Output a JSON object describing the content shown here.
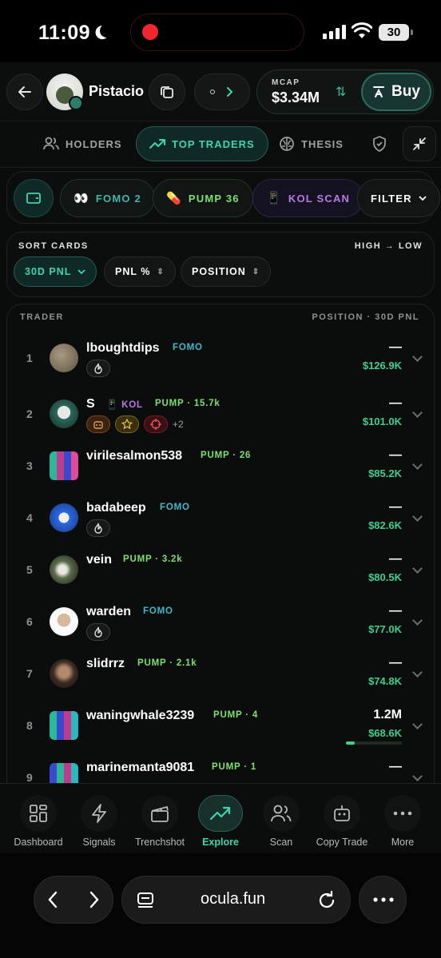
{
  "status_bar": {
    "time": "11:09",
    "battery": "30"
  },
  "token": {
    "name": "Pistacio",
    "mcap_label": "MCAP",
    "mcap_value": "$3.34M",
    "buy_label": "Buy"
  },
  "tabs": [
    {
      "label": "HOLDERS",
      "icon": "users-icon"
    },
    {
      "label": "TOP TRADERS",
      "icon": "trending-up-icon",
      "active": true
    },
    {
      "label": "THESIS",
      "icon": "brain-icon"
    }
  ],
  "filters": [
    {
      "label": "FOMO 2",
      "icon": "eyes-icon",
      "color": "#3fb8a8"
    },
    {
      "label": "PUMP 36",
      "icon": "pill-icon",
      "color": "#7ee06e"
    },
    {
      "label": "KOL SCAN",
      "icon": "phone-icon",
      "color": "#b77be8"
    },
    {
      "label": "FILTER",
      "icon": "chevron-down-icon",
      "color": "#ffffff"
    }
  ],
  "sort": {
    "label": "SORT CARDS",
    "order": "HIGH → LOW",
    "chips": [
      {
        "label": "30D PNL",
        "active": true
      },
      {
        "label": "PNL %"
      },
      {
        "label": "POSITION"
      }
    ]
  },
  "list": {
    "header_left": "TRADER",
    "header_right": "POSITION · 30D PNL",
    "rows": [
      {
        "rank": "1",
        "name": "lboughtdips",
        "tag": "FOMO",
        "tag_color": "#3fb8c8",
        "position": "—",
        "pnl": "$126.9K"
      },
      {
        "rank": "2",
        "name": "S",
        "kol": "KOL",
        "tag": "PUMP · 15.7k",
        "tag_color": "#7ee06e",
        "extra": "+2",
        "position": "—",
        "pnl": "$101.0K"
      },
      {
        "rank": "3",
        "name": "virilesalmon538",
        "tag": "PUMP · 26",
        "tag_color": "#7ee06e",
        "position": "—",
        "pnl": "$85.2K"
      },
      {
        "rank": "4",
        "name": "badabeep",
        "tag": "FOMO",
        "tag_color": "#3fb8c8",
        "position": "—",
        "pnl": "$82.6K"
      },
      {
        "rank": "5",
        "name": "vein",
        "tag": "PUMP · 3.2k",
        "tag_color": "#7ee06e",
        "position": "—",
        "pnl": "$80.5K"
      },
      {
        "rank": "6",
        "name": "warden",
        "tag": "FOMO",
        "tag_color": "#3fb8c8",
        "position": "—",
        "pnl": "$77.0K"
      },
      {
        "rank": "7",
        "name": "slidrrz",
        "tag": "PUMP · 2.1k",
        "tag_color": "#7ee06e",
        "position": "—",
        "pnl": "$74.8K"
      },
      {
        "rank": "8",
        "name": "waningwhale3239",
        "tag": "PUMP · 4",
        "tag_color": "#7ee06e",
        "position": "1.2M",
        "pnl": "$68.6K",
        "position_fill": 0.15
      },
      {
        "rank": "9",
        "name": "marinemanta9081",
        "tag": "PUMP · 1",
        "tag_color": "#7ee06e",
        "position": "—",
        "pnl": ""
      }
    ]
  },
  "nav": [
    {
      "label": "Dashboard",
      "icon": "dashboard-icon"
    },
    {
      "label": "Signals",
      "icon": "lightning-icon"
    },
    {
      "label": "Trenchshot",
      "icon": "clapperboard-icon"
    },
    {
      "label": "Explore",
      "icon": "trending-up-icon",
      "active": true
    },
    {
      "label": "Scan",
      "icon": "users-icon"
    },
    {
      "label": "Copy Trade",
      "icon": "robot-icon"
    },
    {
      "label": "More",
      "icon": "more-icon"
    }
  ],
  "browser": {
    "url": "ocula.fun"
  },
  "colors": {
    "accent": "#3fd6ad",
    "pnl_green": "#3fcf8e",
    "kol_purple": "#b77be8"
  }
}
